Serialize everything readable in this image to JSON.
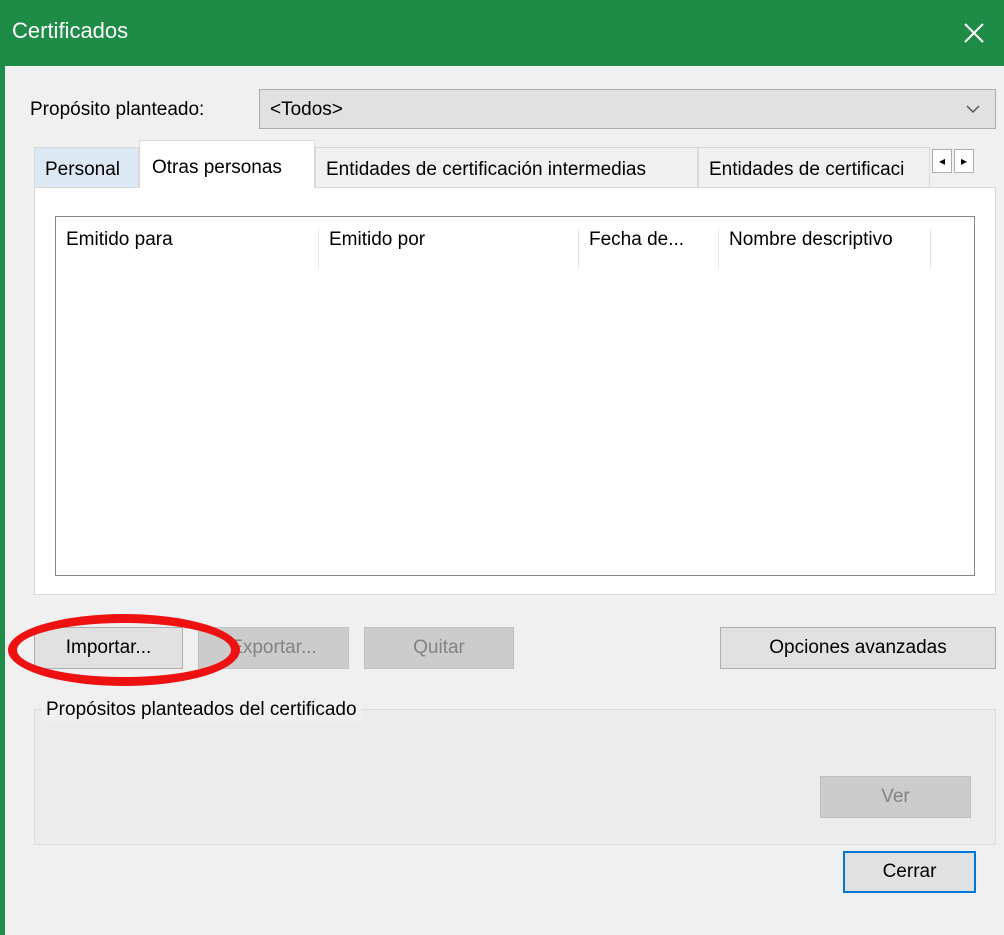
{
  "window": {
    "title": "Certificados",
    "close_glyph": "×"
  },
  "purpose": {
    "label": "Propósito planteado:",
    "selected": "<Todos>"
  },
  "tabs": [
    {
      "label": "Personal",
      "active": false
    },
    {
      "label": "Otras personas",
      "active": true
    },
    {
      "label": "Entidades de certificación intermedias",
      "active": false
    },
    {
      "label": "Entidades de certificaci",
      "active": false
    }
  ],
  "tab_scroll": {
    "left": "◂",
    "right": "▸"
  },
  "list": {
    "columns": [
      "Emitido para",
      "Emitido por",
      "Fecha de...",
      "Nombre descriptivo"
    ],
    "rows": []
  },
  "buttons": {
    "import": "Importar...",
    "export": "Exportar...",
    "remove": "Quitar",
    "advanced": "Opciones avanzadas",
    "view": "Ver",
    "close": "Cerrar"
  },
  "group": {
    "legend": "Propósitos planteados del certificado"
  },
  "colors": {
    "titlebar": "#1e8c46",
    "annotation": "#ee1111",
    "focus": "#0078d7"
  }
}
